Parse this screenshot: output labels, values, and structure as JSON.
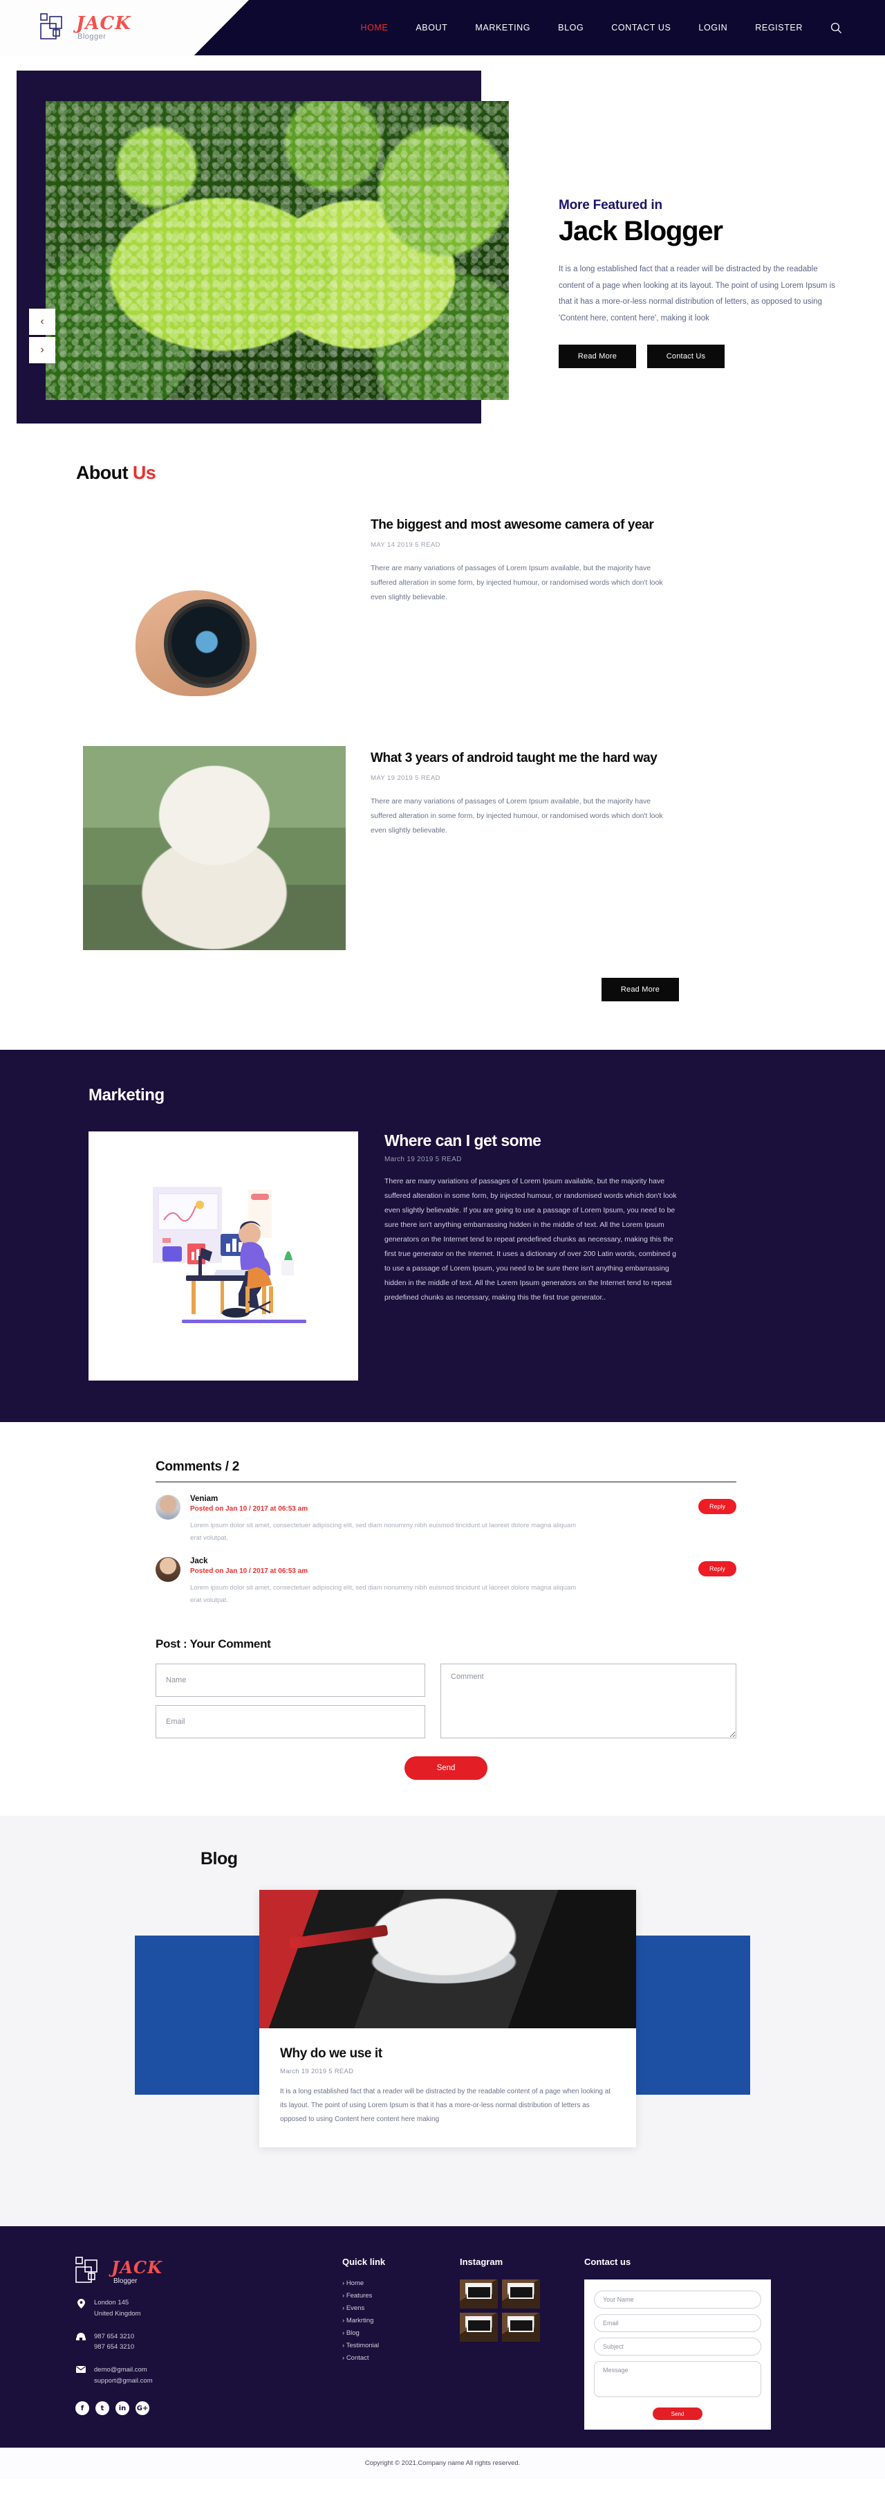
{
  "header": {
    "logo": {
      "name": "JACK",
      "sub": "Blogger"
    },
    "nav": [
      {
        "label": "HOME",
        "active": true
      },
      {
        "label": "ABOUT",
        "active": false
      },
      {
        "label": "MARKETING",
        "active": false
      },
      {
        "label": "BLOG",
        "active": false
      },
      {
        "label": "CONTACT US",
        "active": false
      },
      {
        "label": "LOGIN",
        "active": false
      },
      {
        "label": "REGISTER",
        "active": false
      }
    ],
    "search_icon": "search-icon"
  },
  "hero": {
    "kicker": "More Featured in",
    "title": "Jack Blogger",
    "description": "It is a long established fact that a reader will be distracted by the readable content of a page when looking at its layout. The point of using Lorem Ipsum is that it has a more-or-less normal distribution of letters, as opposed to using 'Content here, content here', making it look",
    "btn_read_more": "Read More",
    "btn_contact": "Contact Us",
    "prev_arrow": "‹",
    "next_arrow": "›"
  },
  "about": {
    "title_main": "About ",
    "title_accent": "Us",
    "read_more": "Read More",
    "cards": [
      {
        "heading": "The biggest and most awesome camera of year",
        "meta": "MAY 14 2019 5 READ",
        "text": "There are many variations of passages of Lorem Ipsum available, but the majority have suffered alteration in some form, by injected humour, or randomised words which don't look even slightly believable."
      },
      {
        "heading": "What 3 years of android taught me the hard way",
        "meta": "MAY 19 2019 5 READ",
        "text": "There are many variations of passages of Lorem Ipsum available, but the majority have suffered alteration in some form, by injected humour, or randomised words which don't look even slightly believable."
      }
    ]
  },
  "marketing": {
    "section_title": "Marketing",
    "heading": "Where can I get some",
    "meta": "March 19 2019 5 READ",
    "text": "There are many variations of passages of Lorem Ipsum available, but the majority have suffered alteration in some form, by injected humour, or randomised words which don't look even slightly believable. If you are going to use a passage of Lorem Ipsum, you need to be sure there isn't anything embarrassing hidden in the middle of text. All the Lorem Ipsum generators on the Internet tend to repeat predefined chunks as necessary, making this the first true generator on the Internet. It uses a dictionary of over 200 Latin words, combined g to use a passage of Lorem Ipsum, you need to be sure there isn't anything embarrassing hidden in the middle of text. All the Lorem Ipsum generators on the Internet tend to repeat predefined chunks as necessary, making this the first true generator.."
  },
  "comments": {
    "title": "Comments / 2",
    "items": [
      {
        "name": "Veniam",
        "date": "Posted on Jan 10 / 2017 at 06:53 am",
        "text": "Lorem ipsum dolor sit amet, consectetuer adipiscing elit, sed diam nonummy nibh euismod tincidunt ut laoreet dolore magna aliquam erat volutpat.",
        "reply": "Reply"
      },
      {
        "name": "Jack",
        "date": "Posted on Jan 10 / 2017 at 06:53 am",
        "text": "Lorem ipsum dolor sit amet, consectetuer adipiscing elit, sed diam nonummy nibh euismod tincidunt ut laoreet dolore magna aliquam erat volutpat.",
        "reply": "Reply"
      }
    ]
  },
  "post_form": {
    "title": "Post : Your Comment",
    "name_placeholder": "Name",
    "email_placeholder": "Email",
    "comment_placeholder": "Comment",
    "send_label": "Send"
  },
  "blog": {
    "section_title": "Blog",
    "heading": "Why do we use it",
    "meta": "March 19 2019 5 READ",
    "text": "It is a long established fact that a reader will be distracted by the readable content of a page when looking at its layout. The point of using Lorem Ipsum is that it has a more-or-less normal distribution of letters as opposed to using Content here content here making"
  },
  "footer": {
    "logo": {
      "name": "JACK",
      "sub": "Blogger"
    },
    "address": "London 145\nUnited Kingdom",
    "phone1": "987 654 3210",
    "phone2": "987 654 3210",
    "email1": "demo@gmail.com",
    "email2": "support@gmail.com",
    "socials": [
      "f",
      "t",
      "in",
      "G+"
    ],
    "quick_link_title": "Quick link",
    "quick_links": [
      "Home",
      "Features",
      "Evens",
      "Markrting",
      "Blog",
      "Testimonial",
      "Contact"
    ],
    "instagram_title": "Instagram",
    "contact_title": "Contact us",
    "contact_form": {
      "name_placeholder": "Your Name",
      "email_placeholder": "Email",
      "subject_placeholder": "Subject",
      "message_placeholder": "Message",
      "send_label": "Send"
    },
    "copyright": "Copyright © 2021.Company name All rights reserved."
  },
  "colors": {
    "navy": "#1b0f3b",
    "header_navy": "#0d0830",
    "red": "#e8302f",
    "blue_band": "#1d4fa3"
  }
}
